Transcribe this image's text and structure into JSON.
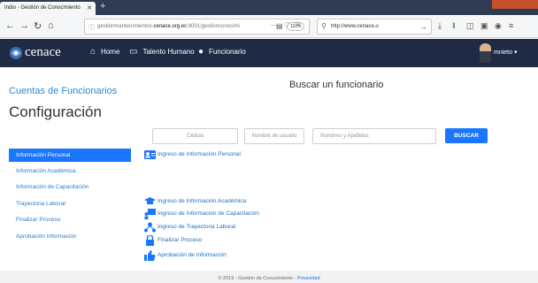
{
  "browser": {
    "tab_title": "Indio - Gestión de Conocimiento",
    "new_tab_icon": "plus-icon",
    "url_prefix": "gestionmantenimientos.",
    "url_domain": "cenace.org.ec",
    "url_suffix": ":8001/gestionconocimi",
    "zoom": "110%",
    "search_value": "http://www.cenace.o"
  },
  "app": {
    "logo_text": "cenace",
    "nav": [
      {
        "label": "Home",
        "icon": "home-icon"
      },
      {
        "label": "Talento Humano",
        "icon": "people-icon"
      },
      {
        "label": "Funcionario",
        "icon": "user-icon"
      }
    ],
    "user": "mnieto"
  },
  "header": {
    "subtitle": "Cuentas de Funcionarios",
    "title": "Configuración"
  },
  "search": {
    "title": "Buscar un funcionario",
    "cedula_placeholder": "Cédula",
    "username_placeholder": "Nombre de usuario",
    "names_placeholder": "Nombres y Apellidos",
    "button": "BUSCAR"
  },
  "sidebar": {
    "items": [
      {
        "label": "Información Personal",
        "active": true
      },
      {
        "label": "Información Académica",
        "active": false
      },
      {
        "label": "Información de Capacitación",
        "active": false
      },
      {
        "label": "Trayectoria Laboral",
        "active": false
      },
      {
        "label": "Finalizar Proceso",
        "active": false
      },
      {
        "label": "Aprobación Información",
        "active": false
      }
    ]
  },
  "content": {
    "links": [
      {
        "label": "Ingreso de Información Personal",
        "icon": "id-card-icon"
      },
      {
        "label": "Ingreso de Información Académica",
        "icon": "graduation-cap-icon"
      },
      {
        "label": "Ingreso de Información de Capacitación",
        "icon": "teacher-icon"
      },
      {
        "label": "Ingreso de Trayectoria Laboral",
        "icon": "network-icon"
      },
      {
        "label": "Finalizar Proceso",
        "icon": "lock-icon"
      },
      {
        "label": "Aprobación de Información",
        "icon": "thumbs-up-icon"
      }
    ]
  },
  "footer": {
    "text": "© 2019 - Gestión de Conocimiento - ",
    "link": "Privacidad"
  },
  "colors": {
    "appbar": "#1f2a44",
    "accent": "#1a75ff",
    "link": "#1f7fd1"
  }
}
